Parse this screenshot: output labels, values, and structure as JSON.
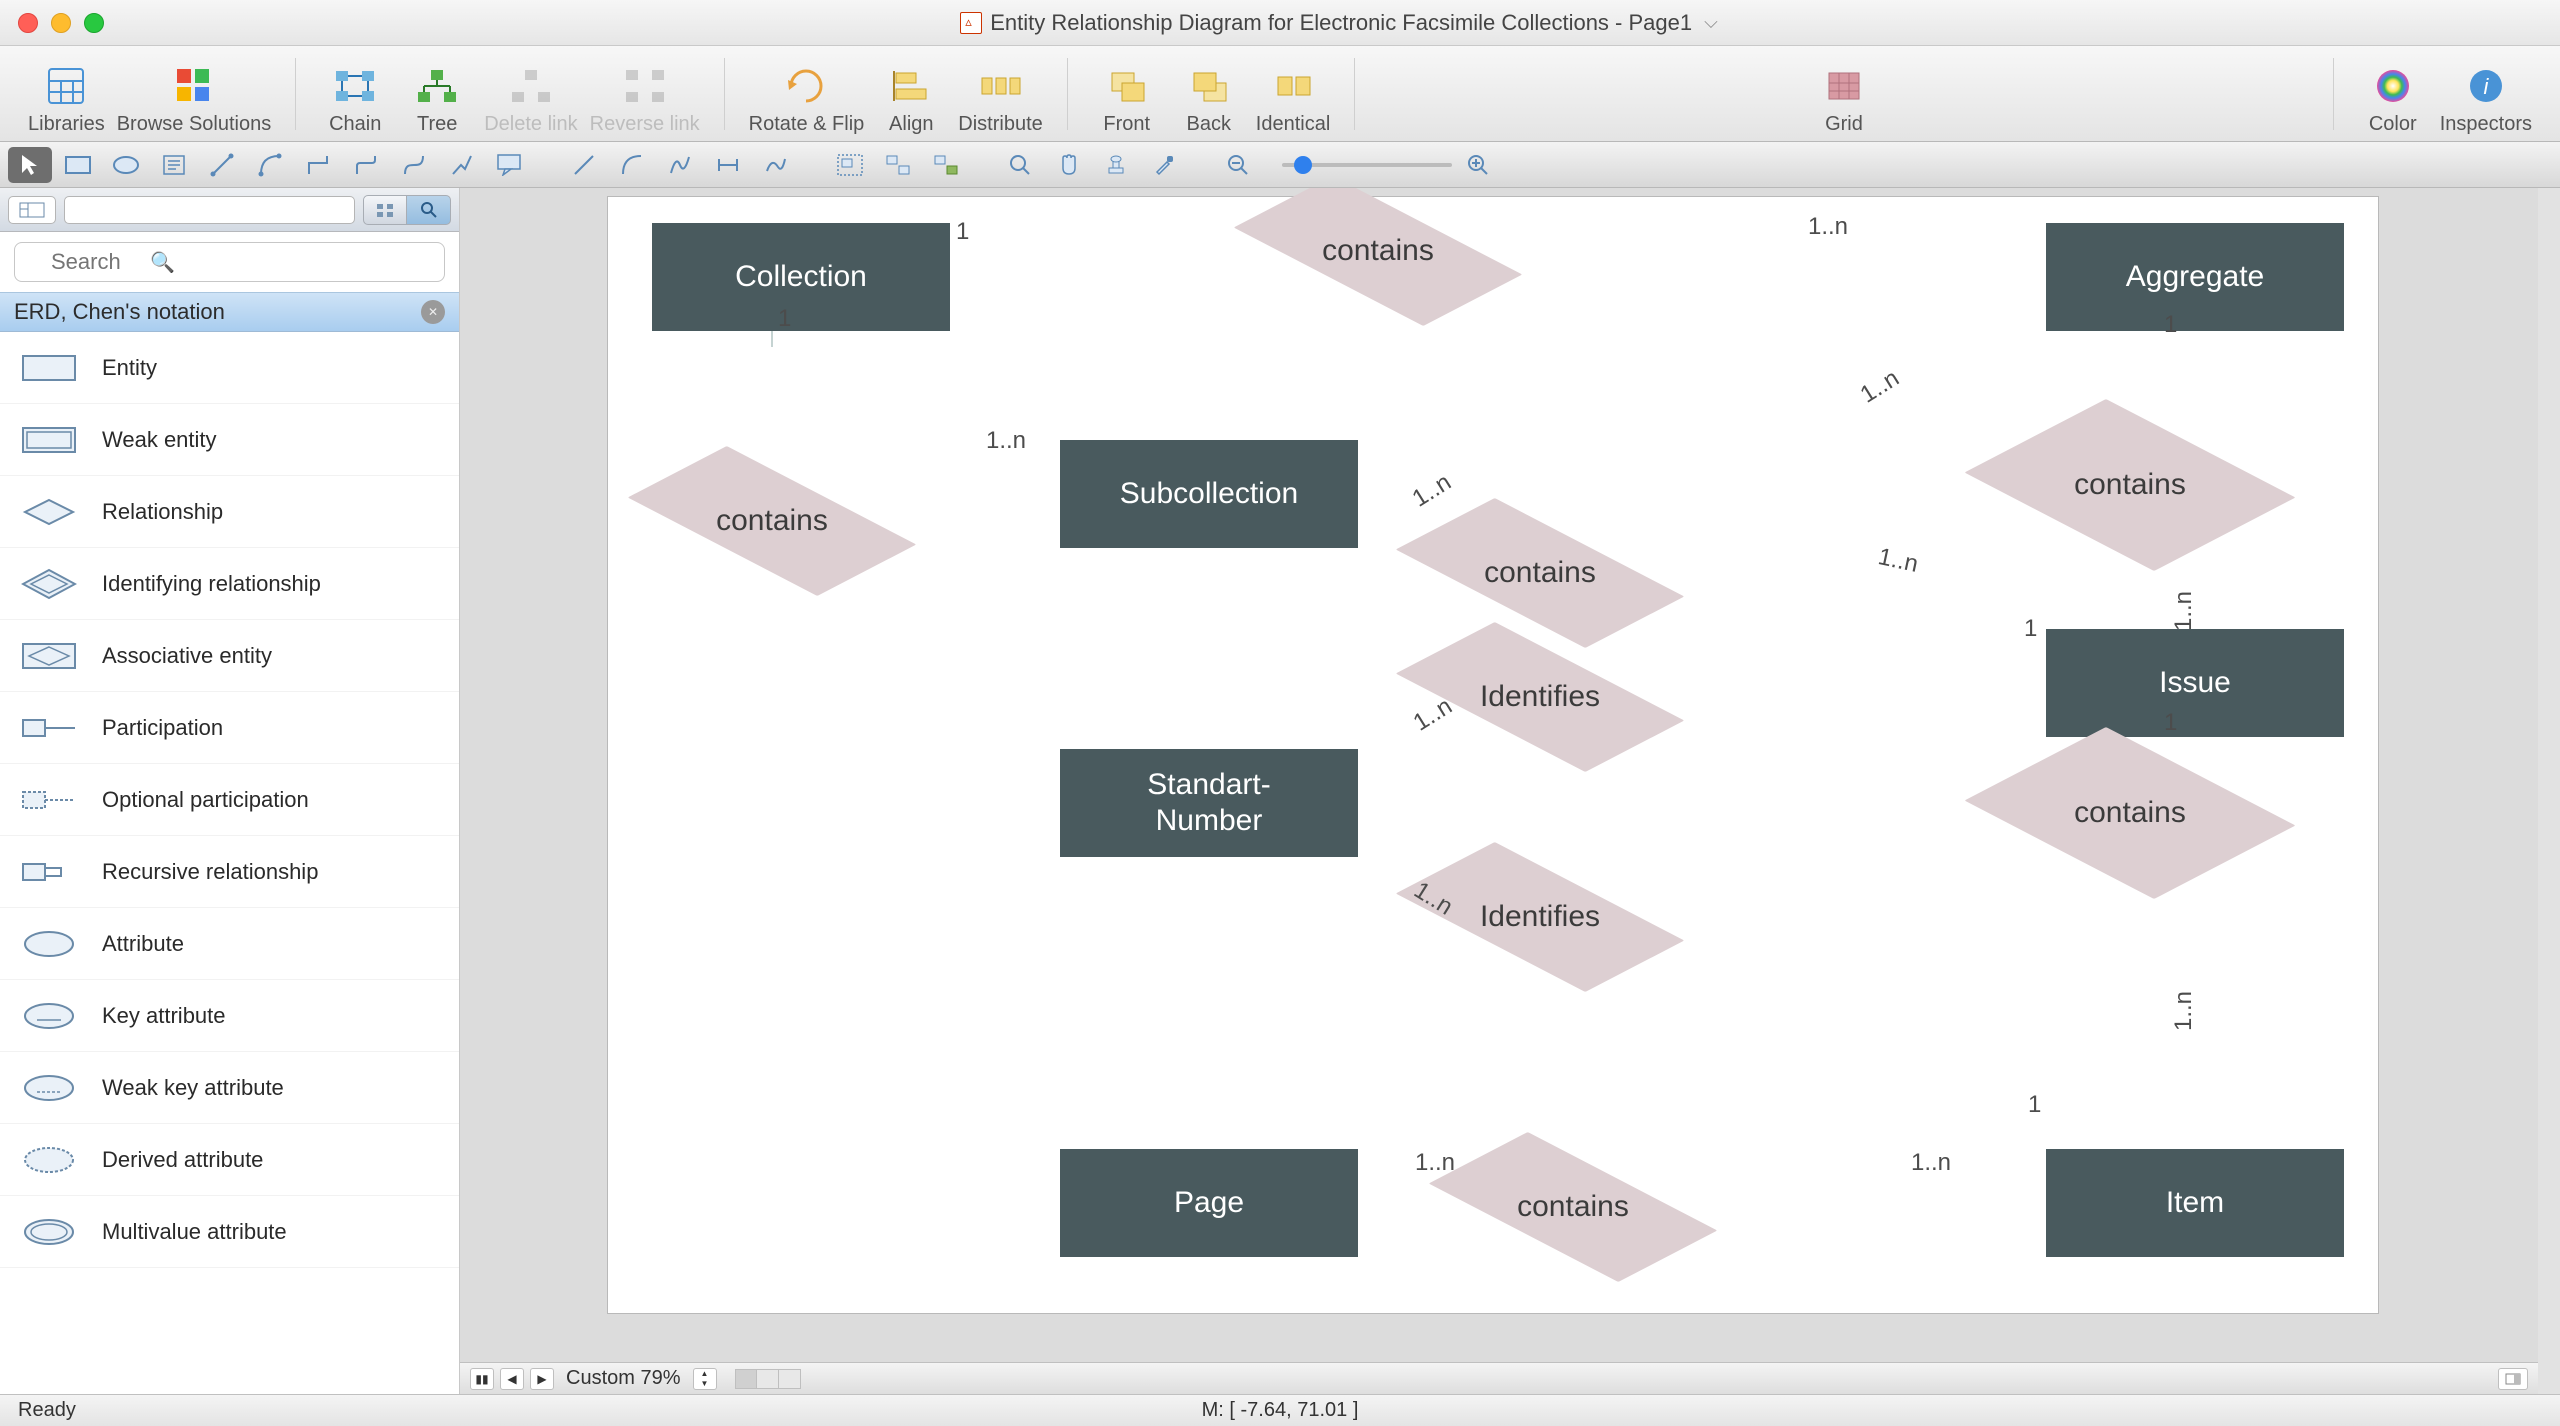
{
  "titlebar": {
    "title": "Entity Relationship Diagram for Electronic Facsimile Collections - Page1"
  },
  "toolbar": {
    "libraries": "Libraries",
    "browse_solutions": "Browse Solutions",
    "chain": "Chain",
    "tree": "Tree",
    "delete_link": "Delete link",
    "reverse_link": "Reverse link",
    "rotate_flip": "Rotate & Flip",
    "align": "Align",
    "distribute": "Distribute",
    "front": "Front",
    "back": "Back",
    "identical": "Identical",
    "grid": "Grid",
    "color": "Color",
    "inspectors": "Inspectors"
  },
  "sidebar": {
    "search_placeholder": "Search",
    "section_title": "ERD, Chen's notation",
    "items": [
      {
        "label": "Entity",
        "shape": "entity"
      },
      {
        "label": "Weak entity",
        "shape": "weak-entity"
      },
      {
        "label": "Relationship",
        "shape": "relationship"
      },
      {
        "label": "Identifying relationship",
        "shape": "ident-relationship"
      },
      {
        "label": "Associative entity",
        "shape": "assoc-entity"
      },
      {
        "label": "Participation",
        "shape": "participation"
      },
      {
        "label": "Optional participation",
        "shape": "opt-participation"
      },
      {
        "label": "Recursive relationship",
        "shape": "recursive"
      },
      {
        "label": "Attribute",
        "shape": "attribute"
      },
      {
        "label": "Key attribute",
        "shape": "key-attr"
      },
      {
        "label": "Weak key attribute",
        "shape": "weak-key-attr"
      },
      {
        "label": "Derived attribute",
        "shape": "derived-attr"
      },
      {
        "label": "Multivalue attribute",
        "shape": "multivalue-attr"
      }
    ]
  },
  "diagram": {
    "entities": {
      "collection": "Collection",
      "aggregate": "Aggregate",
      "subcollection": "Subcollection",
      "issue": "Issue",
      "standart_number": "Standart-\nNumber",
      "page": "Page",
      "item": "Item"
    },
    "relationships": {
      "r1": "contains",
      "r2": "contains",
      "r3": "contains",
      "r4": "contains",
      "r5": "Identifies",
      "r6": "contains",
      "r7": "Identifies",
      "r8": "contains"
    },
    "cardinalities": {
      "c1": "1",
      "c2": "1..n",
      "c3": "1",
      "c4": "1",
      "c5": "1..n",
      "c6": "1..n",
      "c7": "1..n",
      "c8": "1..n",
      "c9": "1",
      "c10": "1",
      "c11": "1..n",
      "c12": "1..n",
      "c13": "1..n",
      "c14": "1",
      "c15": "1..n",
      "c16": "1..n",
      "c17": "1..n"
    }
  },
  "canvas_bottom": {
    "zoom_label": "Custom 79%"
  },
  "statusbar": {
    "ready": "Ready",
    "mouse": "M: [ -7.64, 71.01 ]"
  }
}
